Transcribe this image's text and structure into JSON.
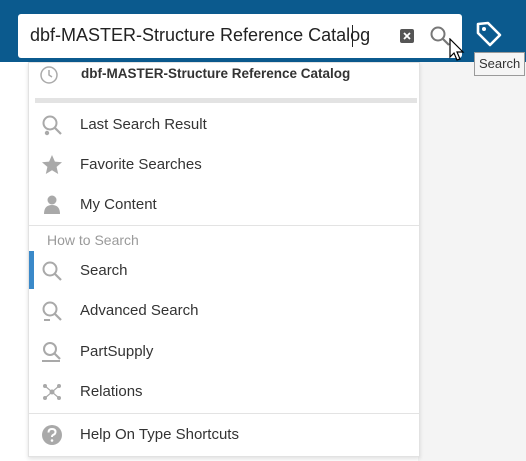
{
  "search": {
    "value": "dbf-MASTER-Structure Reference Catalog",
    "tooltip": "Search"
  },
  "recent": {
    "label": "dbf-MASTER-Structure Reference Catalog",
    "icon": "clock-icon"
  },
  "menu": {
    "items": [
      {
        "label": "Last Search Result",
        "icon": "search-history-icon"
      },
      {
        "label": "Favorite Searches",
        "icon": "star-icon"
      },
      {
        "label": "My Content",
        "icon": "person-icon"
      }
    ],
    "section_header": "How to Search",
    "search_items": [
      {
        "label": "Search",
        "icon": "search-icon"
      },
      {
        "label": "Advanced Search",
        "icon": "advanced-search-icon"
      },
      {
        "label": "PartSupply",
        "icon": "partsupply-search-icon"
      },
      {
        "label": "Relations",
        "icon": "relations-icon"
      }
    ],
    "help": {
      "label": "Help On Type Shortcuts",
      "icon": "help-icon"
    }
  },
  "colors": {
    "topbar": "#0b5a8e",
    "active_indicator": "#3a89c9",
    "icon_gray": "#a9a9a9"
  }
}
